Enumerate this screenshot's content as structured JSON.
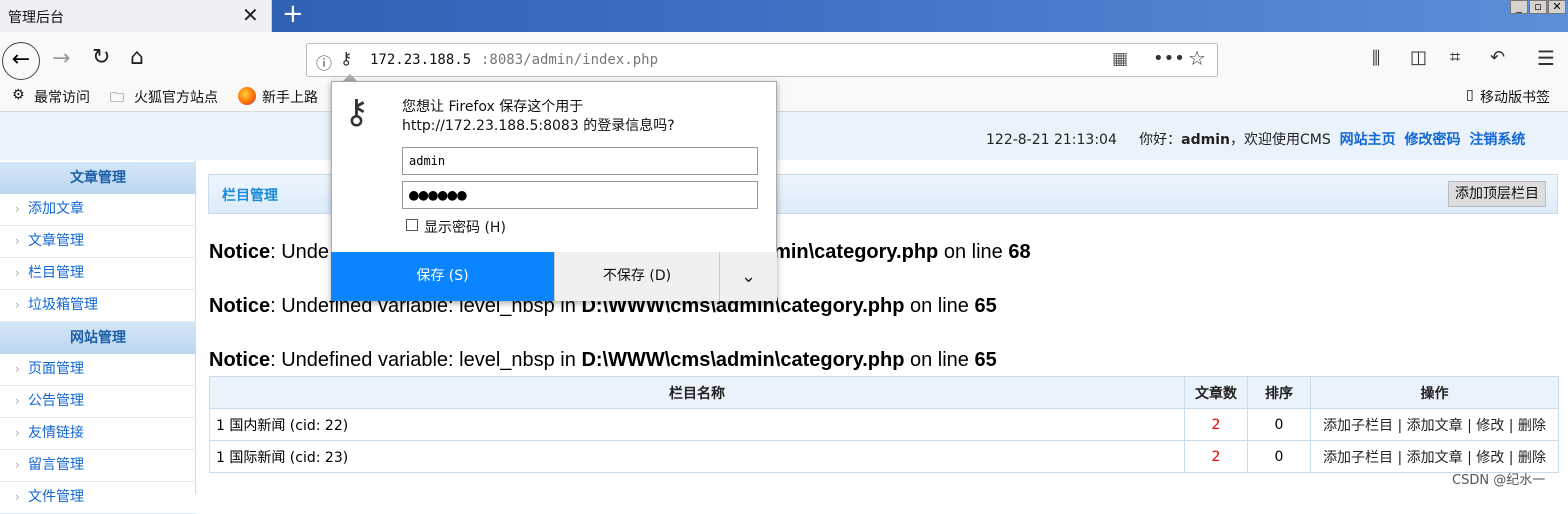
{
  "browser": {
    "tab_title": "管理后台",
    "tab_close": "✕",
    "new_tab": "+",
    "win_min": "_",
    "win_max": "▫",
    "win_close": "✕",
    "url_host": "172.23.188.5",
    "url_rest": ":8083/admin/index.php",
    "bookmarks": [
      "最常访问",
      "火狐官方站点",
      "新手上路"
    ],
    "mobile_bookmarks": "移动版书签"
  },
  "header": {
    "datetime": "122-8-21 21:13:04",
    "greeting_prefix": "你好：",
    "username": "admin",
    "greeting_suffix": "，欢迎使用CMS",
    "links": [
      "网站主页",
      "修改密码",
      "注销系统"
    ]
  },
  "sidebar": {
    "sections": [
      {
        "title": "文章管理",
        "items": [
          "添加文章",
          "文章管理",
          "栏目管理",
          "垃圾箱管理"
        ]
      },
      {
        "title": "网站管理",
        "items": [
          "页面管理",
          "公告管理",
          "友情链接",
          "留言管理",
          "文件管理"
        ]
      }
    ]
  },
  "main": {
    "panel_title": "栏目管理",
    "add_top_button": "添加顶层栏目",
    "notices": [
      {
        "label": "Notice",
        "text_a": ": Unde",
        "file": "min\\category.php",
        "on_line": " on line ",
        "line": "68"
      },
      {
        "label": "Notice",
        "text_a": ": Undefined variable: level_nbsp in ",
        "file": "D:\\WWW\\cms\\admin\\category.php",
        "on_line": " on line ",
        "line": "65"
      },
      {
        "label": "Notice",
        "text_a": ": Undefined variable: level_nbsp in ",
        "file": "D:\\WWW\\cms\\admin\\category.php",
        "on_line": " on line ",
        "line": "65"
      }
    ],
    "table": {
      "headers": [
        "栏目名称",
        "文章数",
        "排序",
        "操作"
      ],
      "rows": [
        {
          "name": "1   国内新闻  (cid: 22)",
          "count": "2",
          "order": "0",
          "ops": "添加子栏目 | 添加文章 | 修改 | 删除"
        },
        {
          "name": "1   国际新闻  (cid: 23)",
          "count": "2",
          "order": "0",
          "ops": "添加子栏目 | 添加文章 | 修改 | 删除"
        }
      ]
    }
  },
  "popup": {
    "question_line1": "您想让 Firefox 保存这个用于",
    "question_line2": "http://172.23.188.5:8083 的登录信息吗?",
    "username_value": "admin",
    "password_value": "●●●●●●",
    "show_password": "显示密码 (H)",
    "save": "保存 (S)",
    "dont_save": "不保存 (D)",
    "more": "⌄"
  },
  "watermark": "CSDN @纪水一"
}
